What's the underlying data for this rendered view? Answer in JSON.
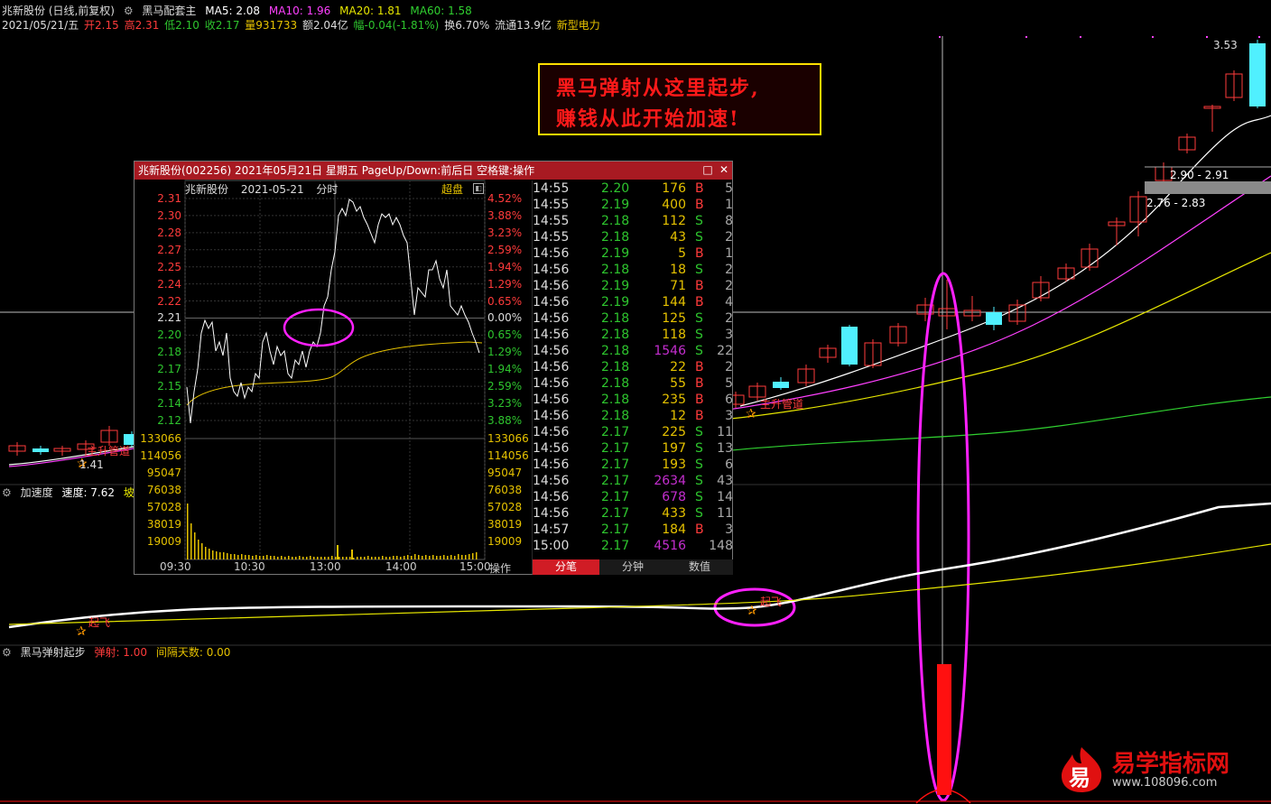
{
  "header": {
    "stock_name": "兆新股份 (日线,前复权)",
    "indicator_name": "黑马配套主",
    "ma5": "MA5: 2.08",
    "ma10": "MA10: 1.96",
    "ma20": "MA20: 1.81",
    "ma60": "MA60: 1.58",
    "date": "2021/05/21/五",
    "open": "开2.15",
    "high": "高2.31",
    "low": "低2.10",
    "close": "收2.17",
    "volume": "量931733",
    "amount": "额2.04亿",
    "change": "幅-0.04(-1.81%)",
    "turnover": "换6.70%",
    "float": "流通13.9亿",
    "sector": "新型电力"
  },
  "price_labels": {
    "high_353": "3.53",
    "range_1": "2.90 - 2.91",
    "range_2": "2.76 - 2.83",
    "low_141": "1.41",
    "signal_1": "主升管道",
    "signal_2": "主升管道"
  },
  "callout": {
    "line1": "黑马弹射从这里起步,",
    "line2": "赚钱从此开始加速!"
  },
  "popup": {
    "title": "兆新股份(002256) 2021年05月21日 星期五 PageUp/Down:前后日 空格键:操作",
    "chart_name": "兆新股份",
    "chart_date": "2021-05-21",
    "chart_kind": "分时",
    "chaopan": "超盘",
    "ops": "操作",
    "price_axis": [
      "2.31",
      "2.30",
      "2.28",
      "2.27",
      "2.25",
      "2.24",
      "2.22",
      "2.21",
      "2.20",
      "2.18",
      "2.17",
      "2.15",
      "2.14",
      "2.12"
    ],
    "pct_axis": [
      "4.52%",
      "3.88%",
      "3.23%",
      "2.59%",
      "1.94%",
      "1.29%",
      "0.65%",
      "0.00%",
      "0.65%",
      "1.29%",
      "1.94%",
      "2.59%",
      "3.23%",
      "3.88%"
    ],
    "vol_axis": [
      "133066",
      "114056",
      "95047",
      "76038",
      "57028",
      "38019",
      "19009"
    ],
    "time_axis": [
      "09:30",
      "10:30",
      "13:00",
      "14:00",
      "15:00"
    ],
    "tabs": [
      "分笔",
      "分钟",
      "数值"
    ],
    "ticks": [
      {
        "t": "14:55",
        "p": "2.20",
        "v": "176",
        "bs": "B",
        "n": "5",
        "c": "#e6c200"
      },
      {
        "t": "14:55",
        "p": "2.19",
        "v": "400",
        "bs": "B",
        "n": "1",
        "c": "#e6c200"
      },
      {
        "t": "14:55",
        "p": "2.18",
        "v": "112",
        "bs": "S",
        "n": "8",
        "c": "#e6c200"
      },
      {
        "t": "14:55",
        "p": "2.18",
        "v": "43",
        "bs": "S",
        "n": "2",
        "c": "#e6c200"
      },
      {
        "t": "14:56",
        "p": "2.19",
        "v": "5",
        "bs": "B",
        "n": "1",
        "c": "#e6c200"
      },
      {
        "t": "14:56",
        "p": "2.18",
        "v": "18",
        "bs": "S",
        "n": "2",
        "c": "#e6c200"
      },
      {
        "t": "14:56",
        "p": "2.19",
        "v": "71",
        "bs": "B",
        "n": "2",
        "c": "#e6c200"
      },
      {
        "t": "14:56",
        "p": "2.19",
        "v": "144",
        "bs": "B",
        "n": "4",
        "c": "#e6c200"
      },
      {
        "t": "14:56",
        "p": "2.18",
        "v": "125",
        "bs": "S",
        "n": "2",
        "c": "#e6c200"
      },
      {
        "t": "14:56",
        "p": "2.18",
        "v": "118",
        "bs": "S",
        "n": "3",
        "c": "#e6c200"
      },
      {
        "t": "14:56",
        "p": "2.18",
        "v": "1546",
        "bs": "S",
        "n": "22",
        "c": "#c42ecf"
      },
      {
        "t": "14:56",
        "p": "2.18",
        "v": "22",
        "bs": "B",
        "n": "2",
        "c": "#e6c200"
      },
      {
        "t": "14:56",
        "p": "2.18",
        "v": "55",
        "bs": "B",
        "n": "5",
        "c": "#e6c200"
      },
      {
        "t": "14:56",
        "p": "2.18",
        "v": "235",
        "bs": "B",
        "n": "6",
        "c": "#e6c200"
      },
      {
        "t": "14:56",
        "p": "2.18",
        "v": "12",
        "bs": "B",
        "n": "3",
        "c": "#e6c200"
      },
      {
        "t": "14:56",
        "p": "2.17",
        "v": "225",
        "bs": "S",
        "n": "11",
        "c": "#e6c200"
      },
      {
        "t": "14:56",
        "p": "2.17",
        "v": "197",
        "bs": "S",
        "n": "13",
        "c": "#e6c200"
      },
      {
        "t": "14:56",
        "p": "2.17",
        "v": "193",
        "bs": "S",
        "n": "6",
        "c": "#e6c200"
      },
      {
        "t": "14:56",
        "p": "2.17",
        "v": "2634",
        "bs": "S",
        "n": "43",
        "c": "#c42ecf"
      },
      {
        "t": "14:56",
        "p": "2.17",
        "v": "678",
        "bs": "S",
        "n": "14",
        "c": "#c42ecf"
      },
      {
        "t": "14:56",
        "p": "2.17",
        "v": "433",
        "bs": "S",
        "n": "11",
        "c": "#e6c200"
      },
      {
        "t": "14:57",
        "p": "2.17",
        "v": "184",
        "bs": "B",
        "n": "3",
        "c": "#e6c200"
      },
      {
        "t": "15:00",
        "p": "2.17",
        "v": "4516",
        "bs": "",
        "n": "148",
        "c": "#c42ecf"
      }
    ]
  },
  "accel_panel": {
    "name": "加速度",
    "speed": "速度: 7.62",
    "slope": "坡速:",
    "signal_a": "起飞",
    "signal_b": "起飞"
  },
  "launch_panel": {
    "name": "黑马弹射起步",
    "launch": "弹射: 1.00",
    "interval": "间隔天数: 0.00"
  },
  "logo": {
    "char": "易",
    "text": "易学指标网",
    "url": "www.108096.com"
  },
  "colors": {
    "up": "#ff3b3b",
    "down": "#50f0ff",
    "ma5": "#ffffff",
    "ma10": "#e6e600",
    "ma20": "#ff40ff",
    "ma60": "#30d030",
    "highlight": "#ff20ff"
  }
}
